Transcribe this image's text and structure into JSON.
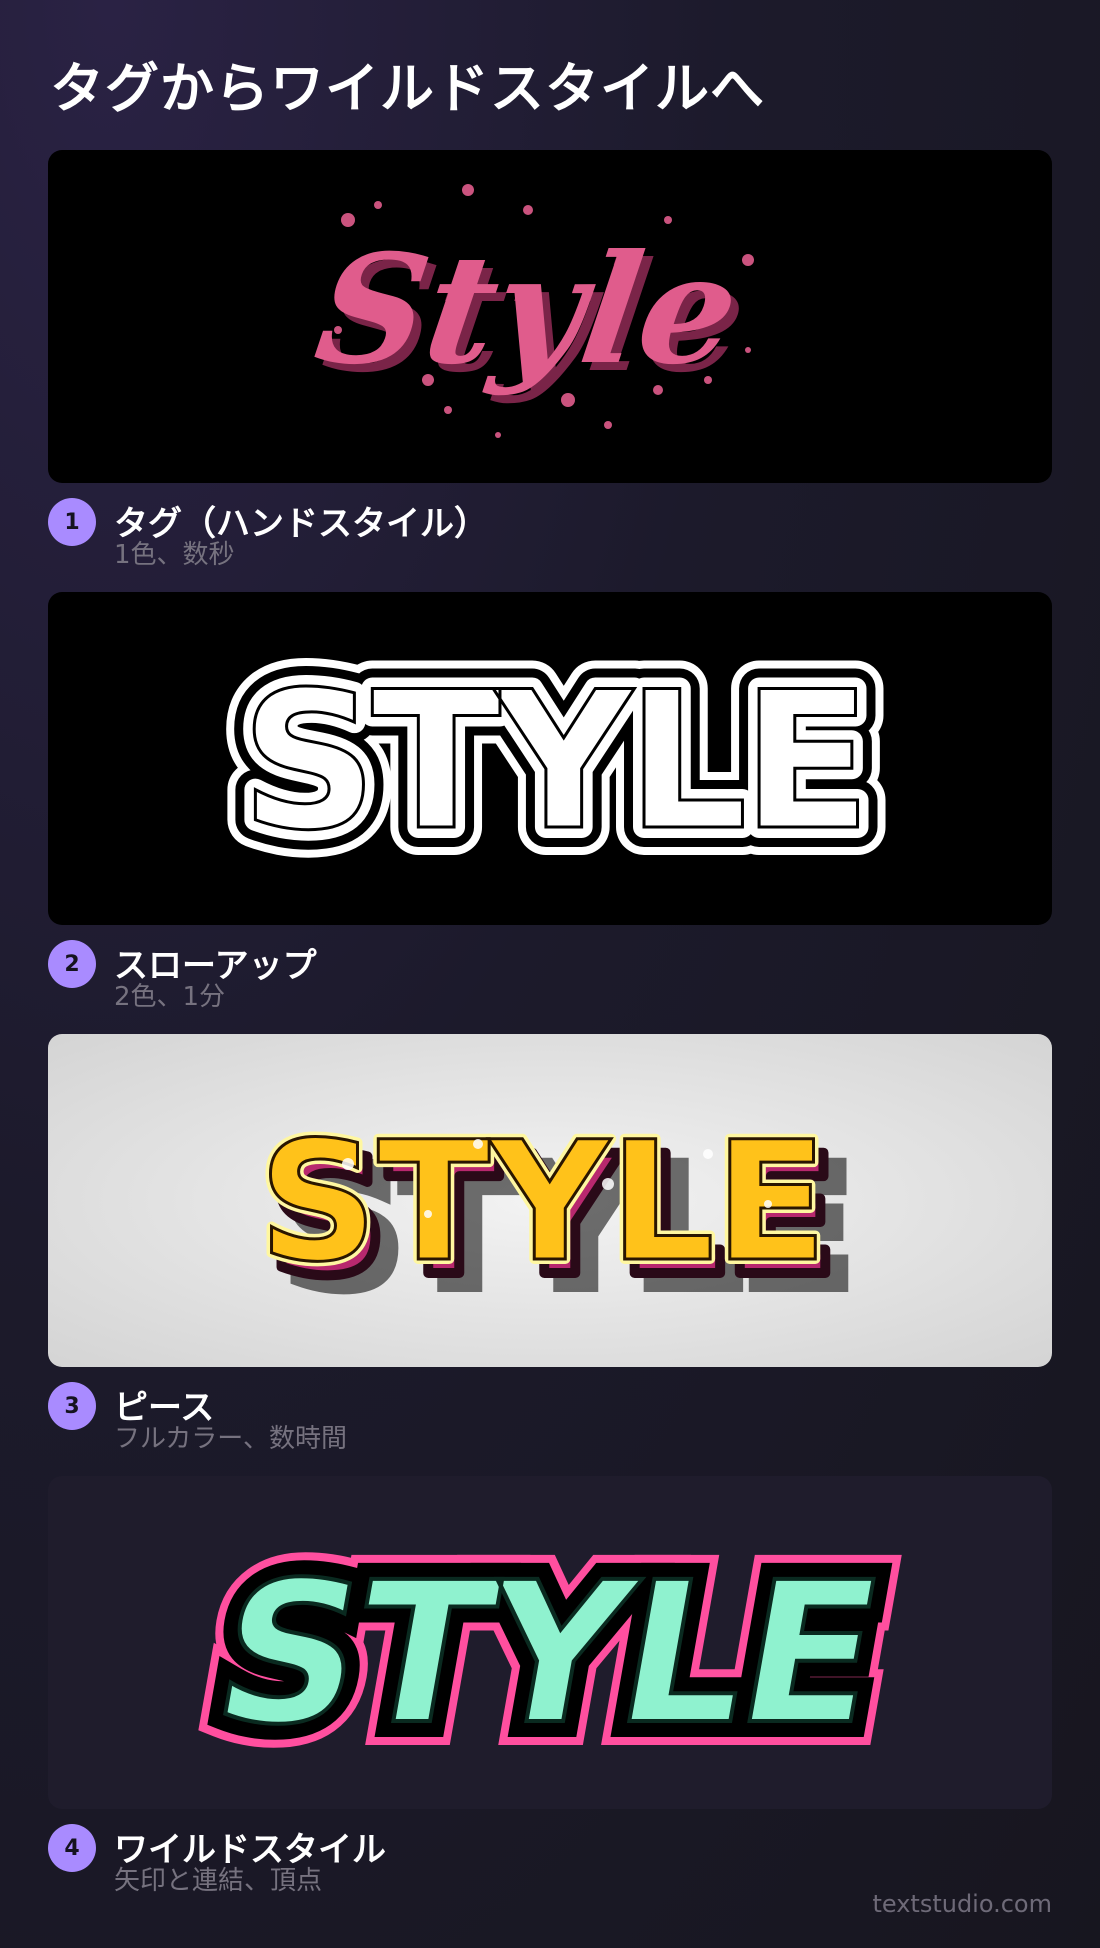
{
  "title": "タグからワイルドスタイルへ",
  "steps": [
    {
      "number": "1",
      "title": "タグ（ハンドスタイル）",
      "subtitle": "1色、数秒",
      "art_text": "Style"
    },
    {
      "number": "2",
      "title": "スローアップ",
      "subtitle": "2色、1分",
      "art_text": "STYLE"
    },
    {
      "number": "3",
      "title": "ピース",
      "subtitle": "フルカラー、数時間",
      "art_text": "STYLE"
    },
    {
      "number": "4",
      "title": "ワイルドスタイル",
      "subtitle": "矢印と連結、頂点",
      "art_text": "STYLE"
    }
  ],
  "footer": "textstudio.com",
  "colors": {
    "accent": "#a98bff",
    "tag_pink": "#e05c8c",
    "piece_yellow": "#ffc21a",
    "piece_magenta": "#b8286e",
    "wild_mint": "#8ff2cf",
    "wild_pink": "#ff4f9f"
  }
}
